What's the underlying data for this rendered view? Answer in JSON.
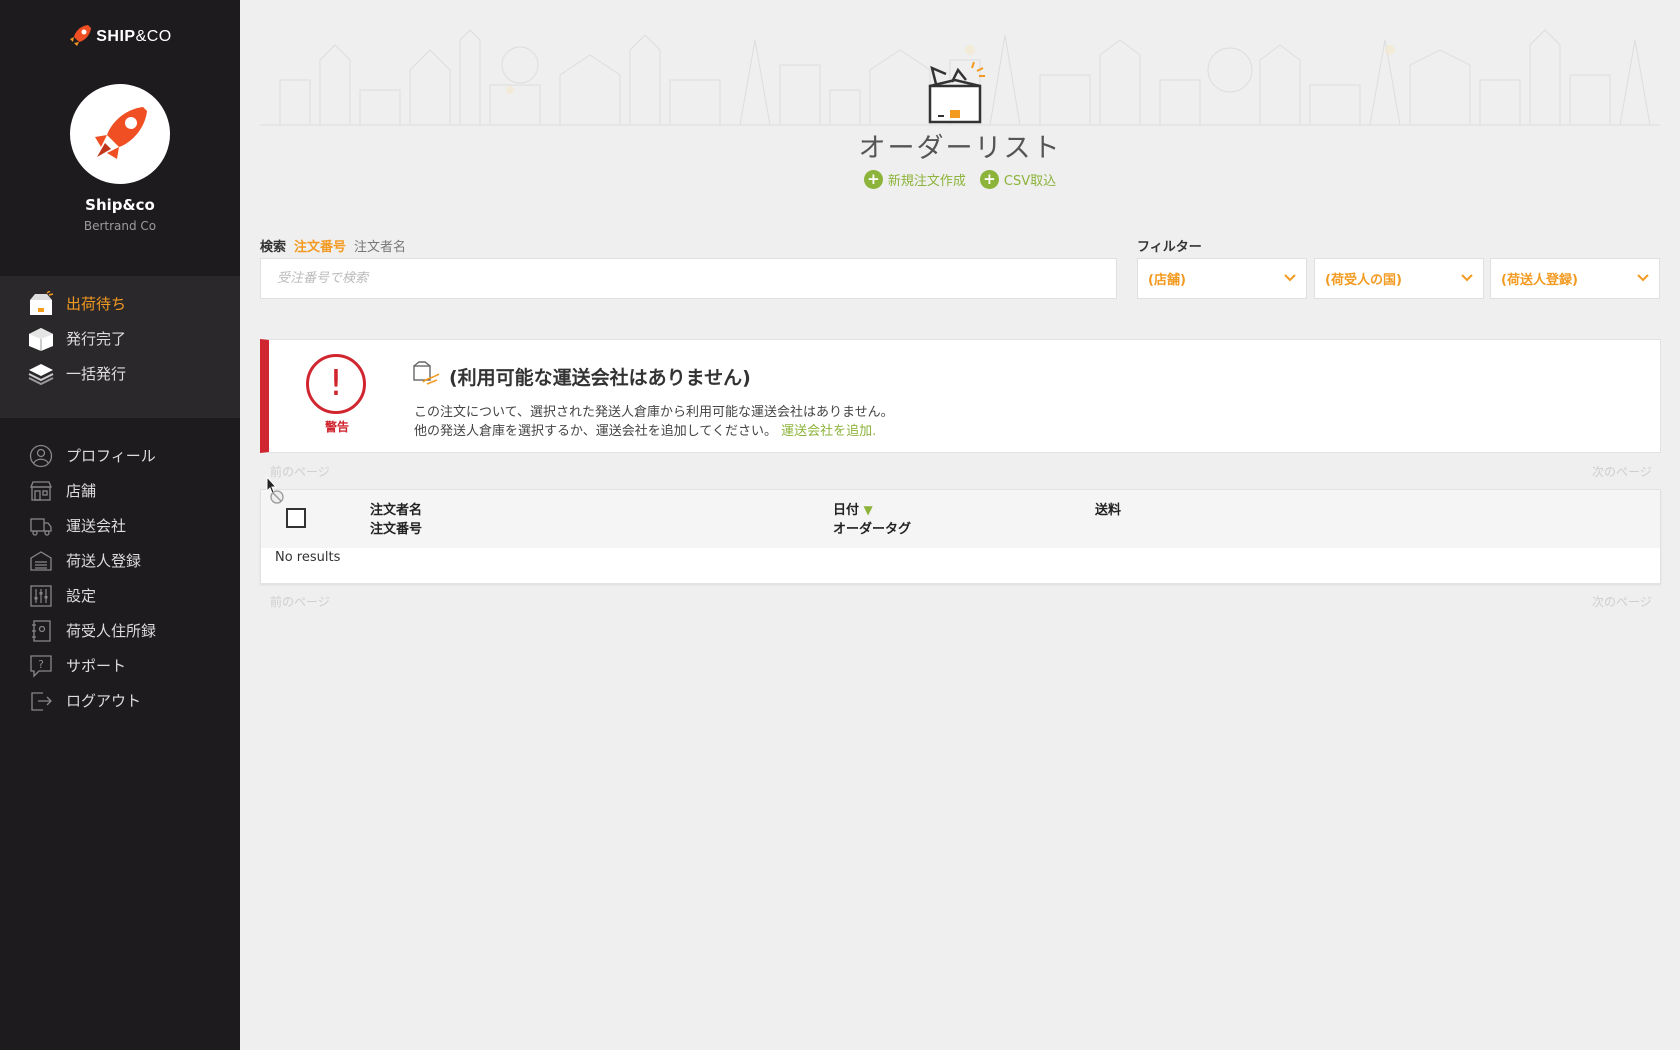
{
  "sidebar": {
    "logo_ship": "SHIP",
    "logo_co": "&CO",
    "account_name": "Ship&co",
    "account_sub": "Bertrand Co",
    "top_items": [
      {
        "label": "出荷待ち",
        "icon": "shipping-box-icon"
      },
      {
        "label": "発行完了",
        "icon": "package-icon"
      },
      {
        "label": "一括発行",
        "icon": "stacked-boxes-icon"
      }
    ],
    "bottom_items": [
      {
        "label": "プロフィール",
        "icon": "user-icon"
      },
      {
        "label": "店舗",
        "icon": "store-icon"
      },
      {
        "label": "運送会社",
        "icon": "truck-icon"
      },
      {
        "label": "荷送人登録",
        "icon": "warehouse-icon"
      },
      {
        "label": "設定",
        "icon": "sliders-icon"
      },
      {
        "label": "荷受人住所録",
        "icon": "address-book-icon"
      },
      {
        "label": "サポート",
        "icon": "help-icon"
      },
      {
        "label": "ログアウト",
        "icon": "logout-icon"
      }
    ]
  },
  "header": {
    "title": "オーダーリスト",
    "action_new": "新規注文作成",
    "action_csv": "CSV取込"
  },
  "search": {
    "label": "検索",
    "option_order_number": "注文番号",
    "option_orderer_name": "注文者名",
    "placeholder": "受注番号で検索"
  },
  "filter": {
    "label": "フィルター",
    "store": "(店舗)",
    "country": "(荷受人の国)",
    "sender": "(荷送人登録)"
  },
  "warning": {
    "label": "警告",
    "title": "(利用可能な運送会社はありません)",
    "line1": "この注文について、選択された発送人倉庫から利用可能な運送会社はありません。",
    "line2": "他の発送人倉庫を選択するか、運送会社を追加してください。",
    "link": "運送会社を追加."
  },
  "pager": {
    "prev": "前のページ",
    "next": "次のページ"
  },
  "table": {
    "col_name": "注文者名",
    "col_number": "注文番号",
    "col_date": "日付",
    "col_tag": "オーダータグ",
    "col_shipping": "送料",
    "empty": "No results"
  },
  "colors": {
    "accent_orange": "#f39a21",
    "accent_green": "#8cb33a",
    "warning_red": "#d0262f",
    "sidebar_bg": "#1e1b1e"
  }
}
